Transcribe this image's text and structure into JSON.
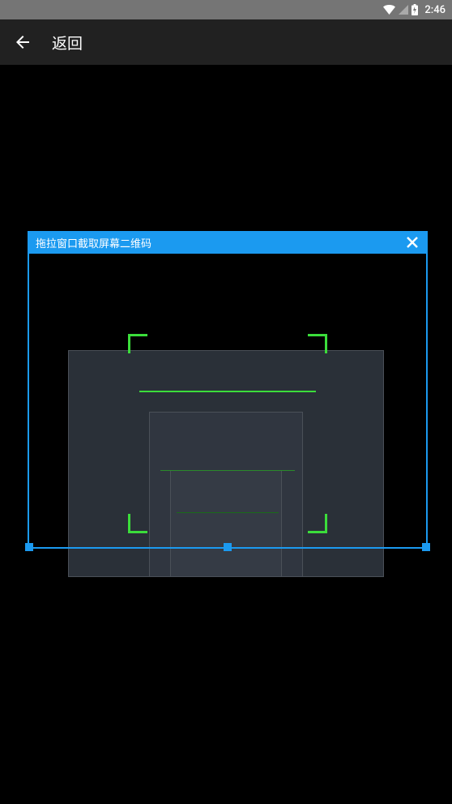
{
  "status_bar": {
    "time": "2:46"
  },
  "app_bar": {
    "title": "返回"
  },
  "crop_overlay": {
    "title": "拖拉窗口截取屏幕二维码"
  },
  "colors": {
    "accent_blue": "#1b9af0",
    "scan_green": "#3bdd3b"
  }
}
